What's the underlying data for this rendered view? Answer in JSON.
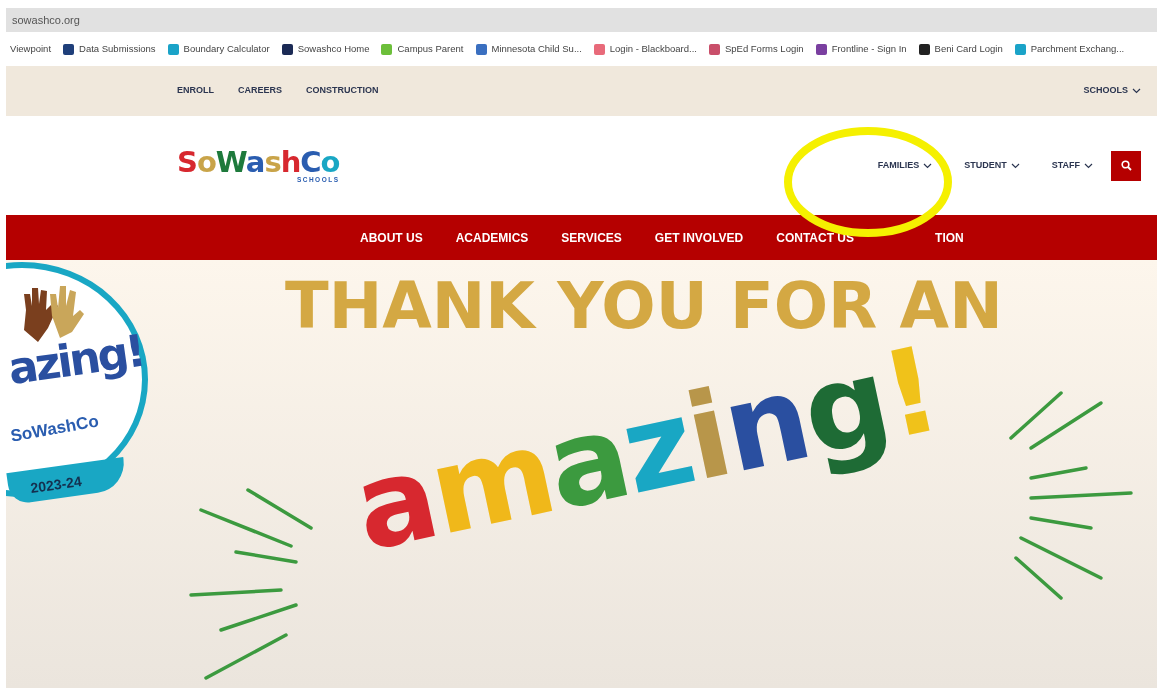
{
  "address_bar": {
    "url": "sowashco.org"
  },
  "bookmarks": [
    {
      "label": "Viewpoint"
    },
    {
      "label": "Data Submissions",
      "color": "#1f3f7a"
    },
    {
      "label": "Boundary Calculator",
      "color": "#1aa3c8"
    },
    {
      "label": "Sowashco Home",
      "color": "#1b2a55"
    },
    {
      "label": "Campus Parent",
      "color": "#6cbf3a"
    },
    {
      "label": "Minnesota Child Su...",
      "color": "#3a6fc0"
    },
    {
      "label": "Login - Blackboard...",
      "color": "#e86a7a"
    },
    {
      "label": "SpEd Forms Login",
      "color": "#c94f6a"
    },
    {
      "label": "Frontline - Sign In",
      "color": "#7a3fa0"
    },
    {
      "label": "Beni Card Login",
      "color": "#222222"
    },
    {
      "label": "Parchment Exchang...",
      "color": "#1aa3c8"
    }
  ],
  "utility_nav": {
    "left": [
      "ENROLL",
      "CAREERS",
      "CONSTRUCTION"
    ],
    "right": "SCHOOLS"
  },
  "logo": {
    "word": "SoWashCo",
    "subtitle": "SCHOOLS"
  },
  "audience_nav": [
    {
      "label": "FAMILIES"
    },
    {
      "label": "STUDENT"
    },
    {
      "label": "STAFF"
    }
  ],
  "main_nav": [
    "ABOUT US",
    "ACADEMICS",
    "SERVICES",
    "GET INVOLVED",
    "CONTACT US",
    "TION"
  ],
  "badge": {
    "word": "azing!",
    "brand": "SoWashCo",
    "year": "2023-24"
  },
  "hero": {
    "heading": "THANK YOU FOR AN",
    "word": "amazing!"
  }
}
